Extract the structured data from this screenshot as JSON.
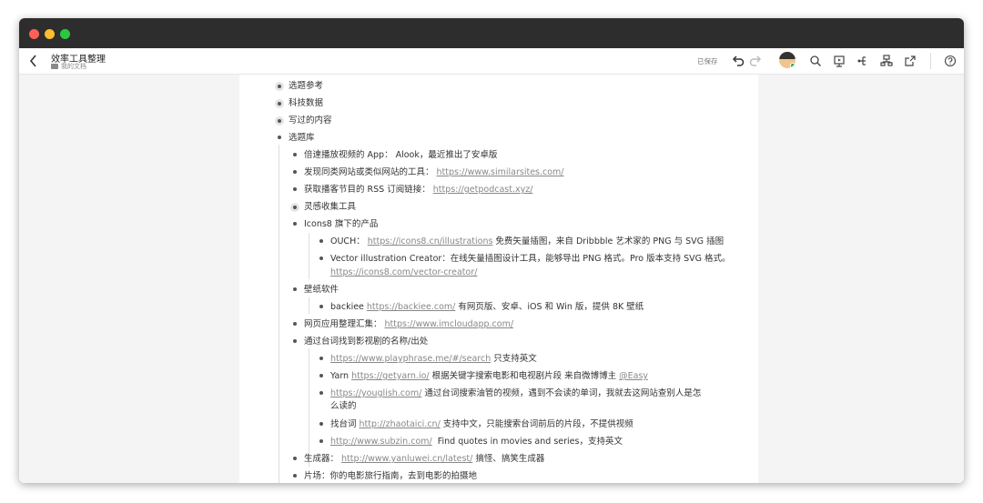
{
  "header": {
    "doc_title": "效率工具整理",
    "breadcrumb": "我的文档",
    "saved_status": "已保存"
  },
  "icons": {
    "back": "chevron-left-icon",
    "undo": "undo-icon",
    "redo": "redo-icon",
    "search": "search-icon",
    "present": "present-icon",
    "mindmap": "mindmap-icon",
    "structure": "structure-icon",
    "share": "share-icon",
    "help": "help-icon"
  },
  "outline": {
    "l0": {
      "topic_ref": "选题参考",
      "tech_data": "科技数据",
      "written": "写过的内容",
      "topic_lib": "选题库"
    },
    "l1": {
      "alook": "倍速播放视频的 App： Alook，最近推出了安卓版",
      "similar_text": "发现同类网站或类似网站的工具：",
      "similar_url": "https://www.similarsites.com/",
      "podcast_text": "获取播客节目的 RSS 订阅链接：",
      "podcast_url": "https://getpodcast.xyz/",
      "inspiration": "灵感收集工具",
      "icons8": "Icons8 旗下的产品",
      "wallpaper": "壁纸软件",
      "webapps_text": "网页应用整理汇集：",
      "webapps_url": "https://www.imcloudapp.com/",
      "quotes": "通过台词找到影视剧的名称/出处",
      "generator_text": "生成器：",
      "generator_url": "http://www.yanluwei.cn/latest/",
      "generator_desc": "搞怪、搞笑生成器",
      "piancang": "片场：你的电影旅行指南，去到电影的拍摄地"
    },
    "l2": {
      "ouch_label": "OUCH：",
      "ouch_url": "https://icons8.cn/illustrations",
      "ouch_desc": "免费矢量插图，来自 Dribbble 艺术家的 PNG 与 SVG 插图",
      "vector_desc": "Vector illustration Creator：在线矢量插图设计工具，能够导出 PNG 格式。Pro 版本支持 SVG 格式。",
      "vector_url": "https://icons8.com/vector-creator/",
      "backiee_label": "backiee",
      "backiee_url": "https://backiee.com/",
      "backiee_desc": "有网页版、安卓、iOS 和 Win 版，提供 8K 壁纸",
      "playphrase_url": "https://www.playphrase.me/#/search",
      "playphrase_desc": "只支持英文",
      "yarn_label": "Yarn",
      "yarn_url": "https://getyarn.io/",
      "yarn_desc": "根据关键字搜索电影和电视剧片段 来自微博博主",
      "yarn_handle": "@Easy",
      "youglish_url": "https://youglish.com/",
      "youglish_desc1": "通过台词搜索油管的视频，遇到不会读的单词，我就去这网站查别人是怎",
      "youglish_desc2": "么读的",
      "zhaotaici_label": "找台词",
      "zhaotaici_url": "http://zhaotaici.cn/",
      "zhaotaici_desc": "支持中文，只能搜索台词前后的片段，不提供视频",
      "subzin_url": "http://www.subzin.com/",
      "subzin_desc": "Find quotes in movies and series，支持英文"
    }
  }
}
